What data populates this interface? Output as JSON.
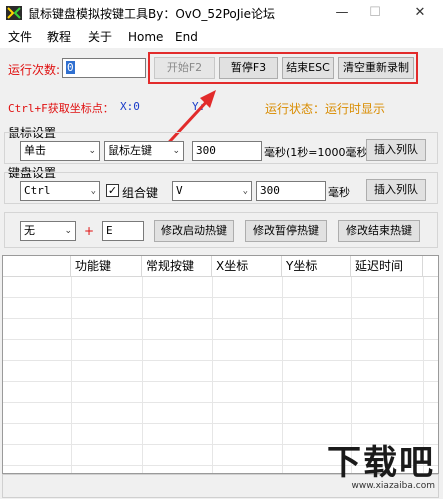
{
  "window": {
    "title": "鼠标键盘模拟按键工具By：OvO_52PoJie论坛",
    "minimize_glyph": "—",
    "maximize_glyph": "☐",
    "close_glyph": "✕"
  },
  "menu": {
    "items": [
      "文件",
      "教程",
      "关于",
      "Home",
      "End"
    ]
  },
  "run": {
    "count_label": "运行次数:",
    "count_value": "0",
    "buttons": {
      "start": "开始F2",
      "pause": "暂停F3",
      "end": "结束ESC",
      "clear": "清空重新录制"
    }
  },
  "coords": {
    "hint": "Ctrl+F获取坐标点：",
    "x_label": "X:0",
    "y_label": "Y:",
    "status": "运行状态：运行时显示"
  },
  "mouse": {
    "section_label": "鼠标设置",
    "action_value": "单击",
    "button_value": "鼠标左键",
    "delay_value": "300",
    "delay_hint": "毫秒(1秒=1000毫秒",
    "insert_button": "插入列队"
  },
  "keyboard": {
    "section_label": "键盘设置",
    "modifier_value": "Ctrl",
    "combo_label": "组合键",
    "combo_checked": true,
    "key_value": "V",
    "delay_value": "300",
    "delay_unit": "毫秒",
    "insert_button": "插入列队"
  },
  "hotkeys": {
    "modifier_value": "无",
    "plus": "+",
    "key_value": "E",
    "start_button": "修改启动热键",
    "pause_button": "修改暂停热键",
    "end_button": "修改结束热键"
  },
  "table": {
    "columns": [
      "",
      "功能键",
      "常规按键",
      "X坐标",
      "Y坐标",
      "延迟时间"
    ]
  },
  "watermark": {
    "text": "下载吧",
    "url": "www.xiazaiba.com"
  },
  "colors": {
    "highlight": "#e22b2b",
    "run_label": "#e01010",
    "hint": "#e01010",
    "status": "#d98c00",
    "x_coord": "#1a3cc8"
  }
}
